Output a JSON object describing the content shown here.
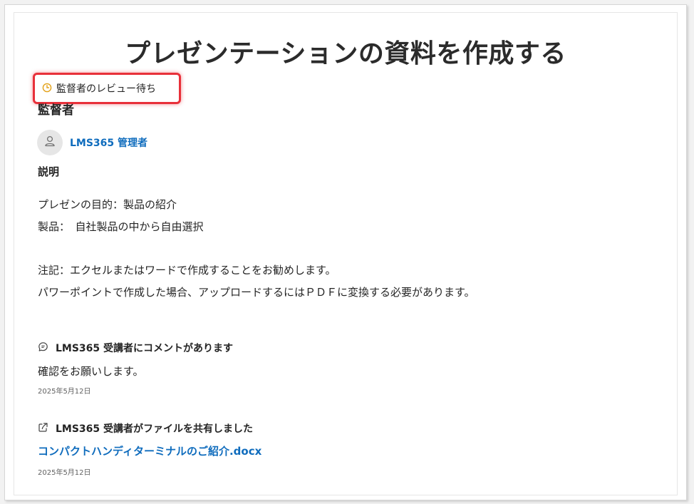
{
  "page": {
    "title": "プレゼンテーションの資料を作成する"
  },
  "status": {
    "icon": "clock-icon",
    "label": "監督者のレビュー待ち",
    "highlight_color": "#e8303a"
  },
  "supervisor": {
    "heading": "監督者",
    "name": "LMS365 管理者",
    "icon": "person-icon"
  },
  "description": {
    "heading": "説明",
    "lines": [
      "プレゼンの目的：製品の紹介",
      "製品：　自社製品の中から自由選択",
      "注記：エクセルまたはワードで作成することをお勧めします。",
      "パワーポイントで作成した場合、アップロードするにはＰＤＦに変換する必要があります。"
    ]
  },
  "activity": [
    {
      "icon": "comment-icon",
      "header": "LMS365 受講者にコメントがあります",
      "body": "確認をお願いします。",
      "date": "2025年5月12日"
    },
    {
      "icon": "share-icon",
      "header": "LMS365 受講者がファイルを共有しました",
      "file_link": "コンパクトハンディターミナルのご紹介.docx",
      "date": "2025年5月12日"
    }
  ],
  "colors": {
    "link": "#0f6cbd",
    "clock": "#e3a21a"
  }
}
